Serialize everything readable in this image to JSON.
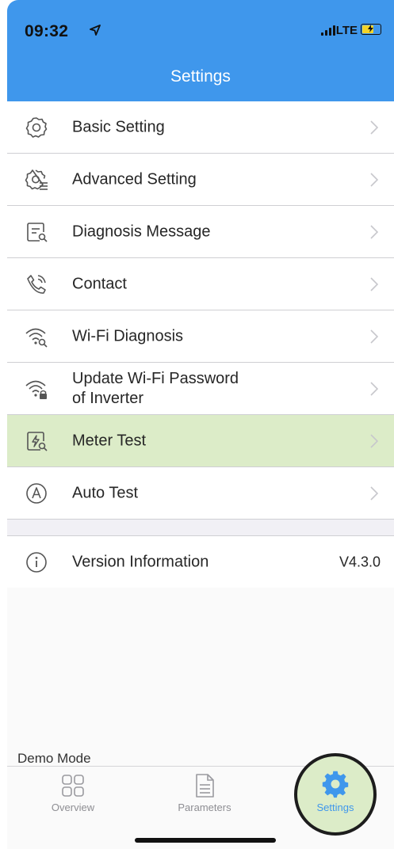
{
  "status_bar": {
    "time": "09:32",
    "network": "LTE"
  },
  "header": {
    "title": "Settings",
    "background_color": "#3f97ec"
  },
  "menu": {
    "items": [
      {
        "label": "Basic Setting",
        "icon": "gear-icon"
      },
      {
        "label": "Advanced Setting",
        "icon": "gear-list-icon"
      },
      {
        "label": "Diagnosis Message",
        "icon": "document-search-icon"
      },
      {
        "label": "Contact",
        "icon": "phone-icon"
      },
      {
        "label": "Wi-Fi Diagnosis",
        "icon": "wifi-search-icon"
      },
      {
        "label": "Update Wi-Fi Password",
        "label_line2": "of Inverter",
        "icon": "wifi-lock-icon"
      },
      {
        "label": "Meter Test",
        "icon": "meter-search-icon",
        "highlighted": true
      },
      {
        "label": "Auto Test",
        "icon": "auto-a-icon"
      }
    ],
    "version": {
      "label": "Version Information",
      "value": "V4.3.0",
      "icon": "info-icon"
    },
    "highlight_color": "#dcecc8"
  },
  "footer": {
    "demo_mode": "Demo Mode"
  },
  "tabbar": {
    "tabs": [
      {
        "label": "Overview",
        "icon": "grid-icon"
      },
      {
        "label": "Parameters",
        "icon": "document-icon"
      },
      {
        "label": "Settings",
        "icon": "gear-icon",
        "active": true
      }
    ],
    "active_color": "#3f97ec"
  }
}
